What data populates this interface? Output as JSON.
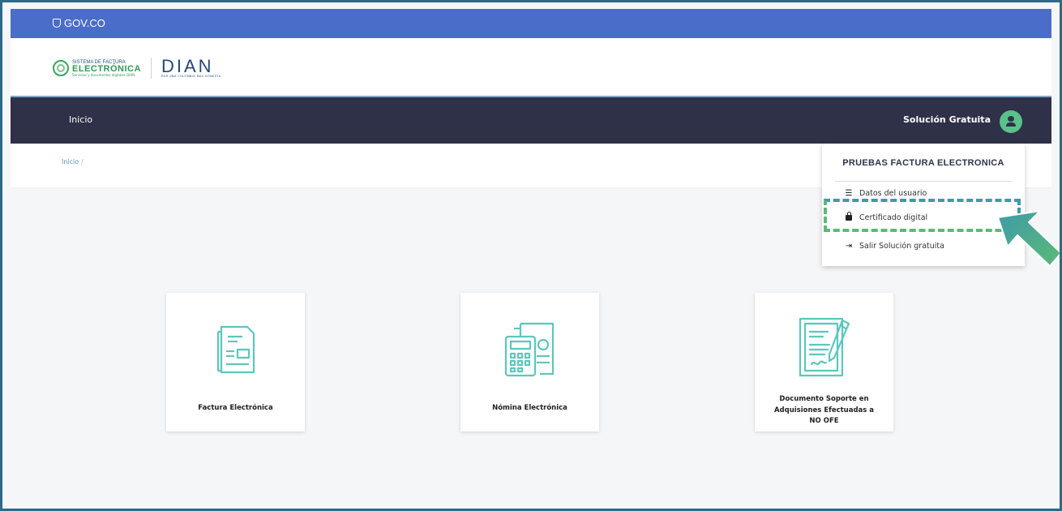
{
  "gov_bar": {
    "label": "GOV.CO"
  },
  "brand": {
    "sf_line1": "SISTEMA DE FACTURA",
    "sf_line2": "ELECTRÓNICA",
    "sf_line3": "Servicios y documentos digitales DIAN",
    "dian": "DIAN",
    "dian_tagline": "POR UNA COLOMBIA MÁS HONESTA"
  },
  "nav": {
    "home": "Inicio",
    "user": "Solución Gratuita"
  },
  "breadcrumb": {
    "home": "Inicio",
    "separator": "/"
  },
  "cards": [
    {
      "label": "Factura Electrónica",
      "icon": "invoice-icon"
    },
    {
      "label": "Nómina Electrónica",
      "icon": "payroll-calculator-icon"
    },
    {
      "label_lines": [
        "Documento Soporte en",
        "Adquisiones Efectuadas a",
        "NO OFE"
      ],
      "icon": "signed-document-icon"
    }
  ],
  "user_menu": {
    "title": "PRUEBAS FACTURA ELECTRONICA",
    "items": [
      {
        "label": "Datos del usuario",
        "icon": "user-data-icon"
      },
      {
        "label": "Certificado digital",
        "icon": "lock-icon"
      },
      {
        "label": "Salir Solución gratuita",
        "icon": "logout-icon"
      }
    ]
  },
  "colors": {
    "gov_bar": "#4a6dc9",
    "nav_bar": "#2f3148",
    "accent_green": "#58c28a",
    "icon_teal": "#5cc7bd",
    "highlight_green": "#5bba76",
    "highlight_blue": "#3f9aa8"
  }
}
